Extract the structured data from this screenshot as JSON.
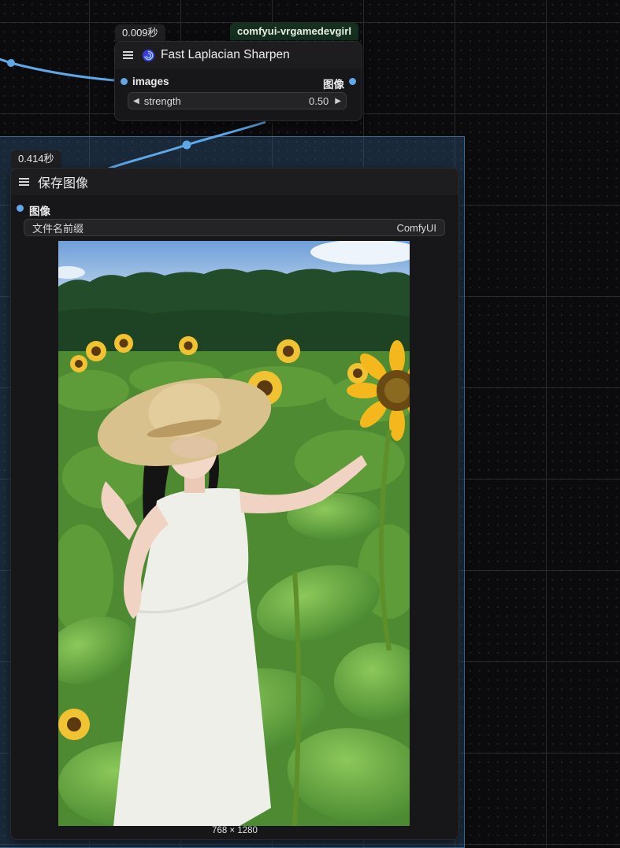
{
  "canvas": {
    "grid_color": "#2a2a2e",
    "wire_color": "#5fa8e8",
    "group_color": "#345d82"
  },
  "sharpen_node": {
    "time_badge": "0.009秒",
    "pack_badge": "comfyui-vrgamedevgirl",
    "title": "Fast Laplacian Sharpen",
    "title_icon": "swirl-icon",
    "input_label": "images",
    "output_label": "图像",
    "strength": {
      "label": "strength",
      "value": "0.50",
      "decrement": "◀",
      "increment": "▶"
    }
  },
  "save_node": {
    "time_badge": "0.414秒",
    "title": "保存图像",
    "input_label": "图像",
    "filename_prefix": {
      "label": "文件名前缀",
      "value": "ComfyUI"
    },
    "preview_dimensions": "768 × 1280"
  }
}
